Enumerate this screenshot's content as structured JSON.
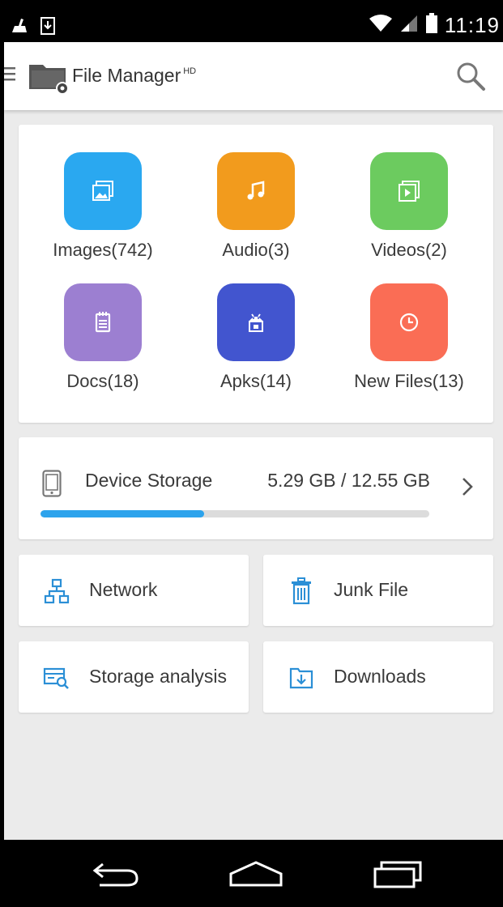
{
  "status_bar": {
    "time": "11:19",
    "icons": [
      "cleaner-icon",
      "download-notification-icon",
      "wifi-icon",
      "signal-icon",
      "battery-icon"
    ]
  },
  "app_bar": {
    "title": "File Manager",
    "title_badge": "HD",
    "icons": [
      "menu-icon",
      "app-logo",
      "search-icon"
    ]
  },
  "categories": [
    {
      "label": "Images(742)",
      "icon": "image-icon",
      "color": "#2aa8f0"
    },
    {
      "label": "Audio(3)",
      "icon": "music-note-icon",
      "color": "#f29b1d"
    },
    {
      "label": "Videos(2)",
      "icon": "video-icon",
      "color": "#6ccb5f"
    },
    {
      "label": "Docs(18)",
      "icon": "document-icon",
      "color": "#9c7fd1"
    },
    {
      "label": "Apks(14)",
      "icon": "android-icon",
      "color": "#4255cf"
    },
    {
      "label": "New Files(13)",
      "icon": "clock-icon",
      "color": "#fa6d55"
    }
  ],
  "storage": {
    "label": "Device Storage",
    "usage": "5.29 GB / 12.55 GB",
    "used_fraction": 0.42,
    "accent": "#2da3ec"
  },
  "tools": [
    {
      "label": "Network",
      "icon": "network-icon"
    },
    {
      "label": "Junk File",
      "icon": "trash-icon"
    },
    {
      "label": "Storage analysis",
      "icon": "storage-analysis-icon"
    },
    {
      "label": "Downloads",
      "icon": "downloads-folder-icon"
    }
  ],
  "nav_bar": {
    "icons": [
      "back-icon",
      "home-icon",
      "recents-icon"
    ]
  }
}
